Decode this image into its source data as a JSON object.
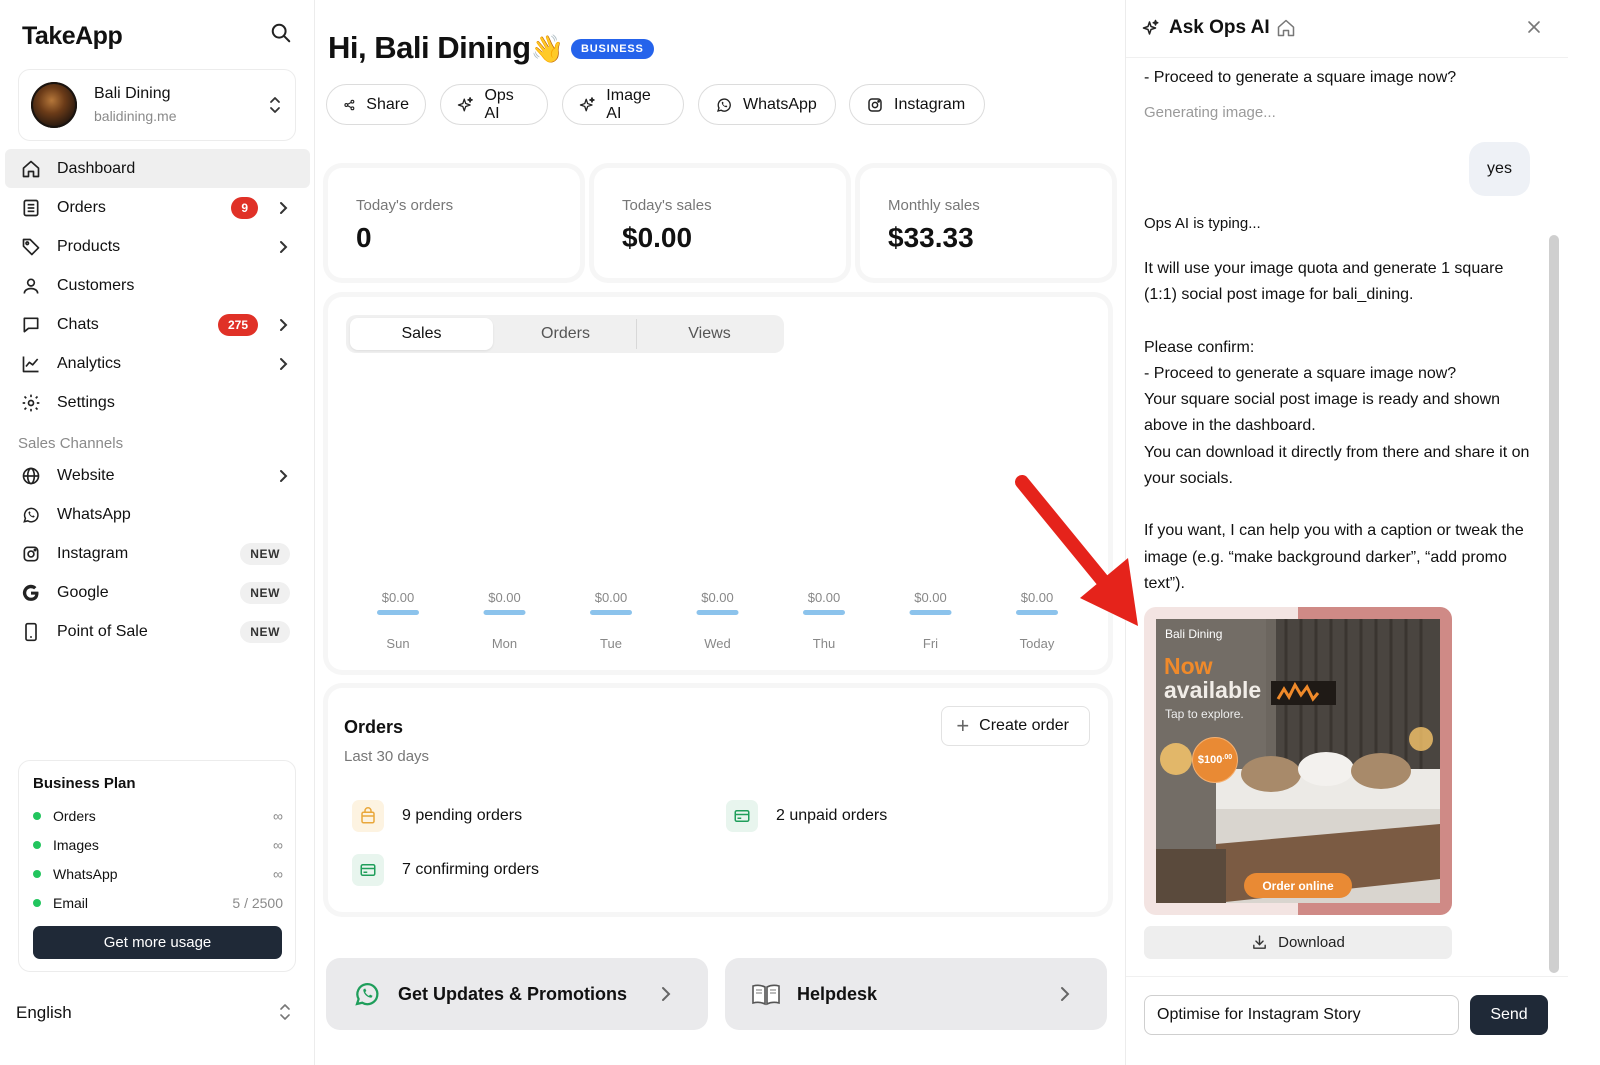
{
  "brand": {
    "name": "TakeApp"
  },
  "account": {
    "name": "Bali Dining",
    "domain": "balidining.me"
  },
  "nav": [
    {
      "label": "Dashboard",
      "icon": "home-icon",
      "active": true
    },
    {
      "label": "Orders",
      "icon": "orders-icon",
      "badge": "9",
      "chevron": true
    },
    {
      "label": "Products",
      "icon": "tag-icon",
      "chevron": true
    },
    {
      "label": "Customers",
      "icon": "user-icon"
    },
    {
      "label": "Chats",
      "icon": "chat-icon",
      "badge": "275",
      "chevron": true
    },
    {
      "label": "Analytics",
      "icon": "analytics-icon",
      "chevron": true
    },
    {
      "label": "Settings",
      "icon": "gear-icon"
    }
  ],
  "sales_channels": {
    "title": "Sales Channels",
    "items": [
      {
        "label": "Website",
        "icon": "globe-icon",
        "chevron": true
      },
      {
        "label": "WhatsApp",
        "icon": "whatsapp-icon"
      },
      {
        "label": "Instagram",
        "icon": "instagram-icon",
        "tag": "NEW"
      },
      {
        "label": "Google",
        "icon": "google-icon",
        "tag": "NEW"
      },
      {
        "label": "Point of Sale",
        "icon": "pos-icon",
        "tag": "NEW"
      }
    ]
  },
  "plan": {
    "title": "Business Plan",
    "rows": [
      {
        "label": "Orders",
        "value": "∞"
      },
      {
        "label": "Images",
        "value": "∞"
      },
      {
        "label": "WhatsApp",
        "value": "∞"
      },
      {
        "label": "Email",
        "value": "5 / 2500"
      }
    ],
    "button": "Get more usage"
  },
  "language": "English",
  "header": {
    "greeting": "Hi, Bali Dining",
    "emoji": "👋",
    "badge": "BUSINESS"
  },
  "quick_actions": [
    {
      "label": "Share",
      "icon": "share-icon"
    },
    {
      "label": "Ops AI",
      "icon": "sparkle-icon"
    },
    {
      "label": "Image AI",
      "icon": "sparkle-icon"
    },
    {
      "label": "WhatsApp",
      "icon": "whatsapp-icon"
    },
    {
      "label": "Instagram",
      "icon": "instagram-icon"
    }
  ],
  "stats": [
    {
      "label": "Today's orders",
      "value": "0"
    },
    {
      "label": "Today's sales",
      "value": "$0.00"
    },
    {
      "label": "Monthly sales",
      "value": "$33.33"
    }
  ],
  "chart_tabs": [
    "Sales",
    "Orders",
    "Views"
  ],
  "chart_data": {
    "type": "bar",
    "categories": [
      "Sun",
      "Mon",
      "Tue",
      "Wed",
      "Thu",
      "Fri",
      "Today"
    ],
    "values": [
      0,
      0,
      0,
      0,
      0,
      0,
      0
    ],
    "value_labels": [
      "$0.00",
      "$0.00",
      "$0.00",
      "$0.00",
      "$0.00",
      "$0.00",
      "$0.00"
    ],
    "bar_color": "#8cc3ec"
  },
  "orders_summary": {
    "title": "Orders",
    "subtitle": "Last 30 days",
    "create_button": "Create order",
    "items": [
      {
        "label": "9 pending orders",
        "icon": "bag-icon"
      },
      {
        "label": "2 unpaid orders",
        "icon": "card-icon"
      },
      {
        "label": "7 confirming orders",
        "icon": "card-icon"
      }
    ]
  },
  "promos": [
    {
      "label": "Get Updates & Promotions",
      "icon": "whatsapp-icon"
    },
    {
      "label": "Helpdesk",
      "icon": "book-icon"
    }
  ],
  "assistant": {
    "title": "Ask Ops AI",
    "top_line": "- Proceed to generate a square image now?",
    "status_line": "Generating image...",
    "user_reply": "yes",
    "typing": "Ops AI is typing...",
    "message": [
      "It will use your image quota and generate 1 square (1:1) social post image for bali_dining.",
      "",
      "Please confirm:",
      "- Proceed to generate a square image now?",
      "Your square social post image is ready and shown above in the dashboard.",
      "You can download it directly from there and share it on your socials.",
      "",
      "If you want, I can help you with a caption or tweak the image (e.g. “make background darker”, “add promo text”)."
    ],
    "image": {
      "brand": "Bali Dining",
      "headline_1": "Now",
      "headline_2": "available",
      "sub": "Tap to explore.",
      "price": "$100",
      "price_cents": ".00",
      "cta": "Order online"
    },
    "download": "Download",
    "input_value": "Optimise for Instagram Story",
    "send": "Send"
  },
  "colors": {
    "accent": "#2563eb",
    "badge_red": "#e03127",
    "status_green": "#22c55e",
    "dark_button": "#1f2937",
    "arrow": "#e5231b"
  }
}
